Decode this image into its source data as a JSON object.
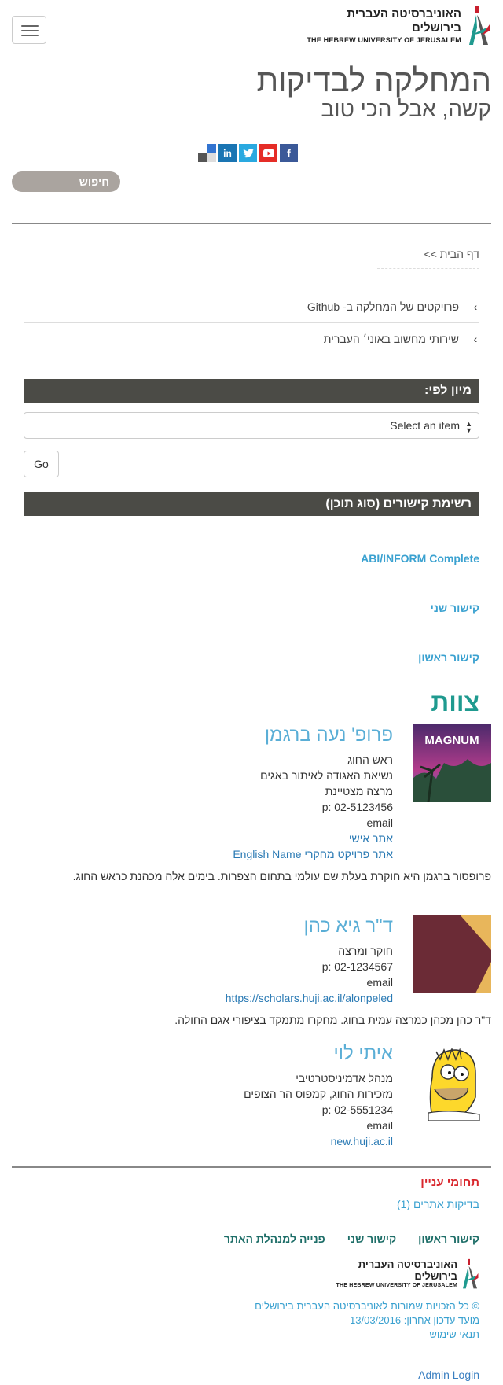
{
  "header": {
    "logo_he": "האוניברסיטה העברית בירושלים",
    "logo_en": "THE HEBREW UNIVERSITY OF JERUSALEM",
    "site_title": "המחלקה לבדיקות",
    "site_slogan": "קשה, אבל הכי טוב"
  },
  "social": [
    {
      "icon": "facebook-icon",
      "glyph": "f",
      "color": "#3b5998"
    },
    {
      "icon": "youtube-icon",
      "glyph": "▶",
      "color": "#e52d27"
    },
    {
      "icon": "twitter-icon",
      "glyph": "t",
      "color": "#2aa9e0"
    },
    {
      "icon": "linkedin-icon",
      "glyph": "in",
      "color": "#1a75b3"
    },
    {
      "icon": "delicious-icon",
      "glyph": "",
      "color": "#3274d1"
    }
  ],
  "search": {
    "label": "חיפוש"
  },
  "breadcrumb": {
    "label": "דף הבית >>"
  },
  "external_links": [
    {
      "label": "פרויקטים של המחלקה ב- Github"
    },
    {
      "label": "שירותי מחשוב באוני׳ העברית"
    }
  ],
  "sort": {
    "title": "מיון לפי:",
    "select_value": "Select an item",
    "go_label": "Go"
  },
  "links_block": {
    "title": "רשימת קישורים (סוג תוכן)",
    "items": [
      "ABI/INFORM Complete",
      "קישור שני",
      "קישור ראשון"
    ]
  },
  "team": {
    "title": "צוות",
    "people": [
      {
        "name": "פרופ' נעה ברגמן",
        "photo_text": "MAGNUM",
        "lines": [
          "ראש החוג",
          "נשיאת האגודה לאיתור באגים",
          "מרצה מצטיינת",
          "p: 02-5123456",
          "email"
        ],
        "links": [
          "אתר אישי",
          "אתר פרויקט מחקרי English Name"
        ],
        "desc": "פרופסור ברגמן היא חוקרת בעלת שם עולמי בתחום הצפרות. בימים אלה מכהנת כראש החוג."
      },
      {
        "name": "ד\"ר גיא כהן",
        "lines": [
          "חוקר ומרצה",
          "p: 02-1234567",
          "email"
        ],
        "links": [
          "https://scholars.huji.ac.il/alonpeled"
        ],
        "desc": "ד\"ר כהן מכהן כמרצה עמית בחוג. מחקרו מתמקד בציפורי אגם החולה."
      },
      {
        "name": "איתי לוי",
        "lines": [
          "מנהל אדמיניסטרטיבי",
          "מזכירות החוג, קמפוס הר הצופים",
          "p: 02-5551234",
          "email"
        ],
        "links": [
          "new.huji.ac.il"
        ],
        "desc": ""
      }
    ]
  },
  "interests": {
    "title": "תחומי עניין",
    "link": "בדיקות אתרים (1)"
  },
  "footer": {
    "menu": [
      "קישור ראשון",
      "קישור שני",
      "פנייה למנהלת האתר"
    ],
    "copyright": "© כל הזכויות שמורות לאוניברסיטה העברית בירושלים",
    "updated": "מועד עדכון אחרון: 13/03/2016",
    "terms": "תנאי שימוש",
    "admin_login": "Admin Login"
  }
}
